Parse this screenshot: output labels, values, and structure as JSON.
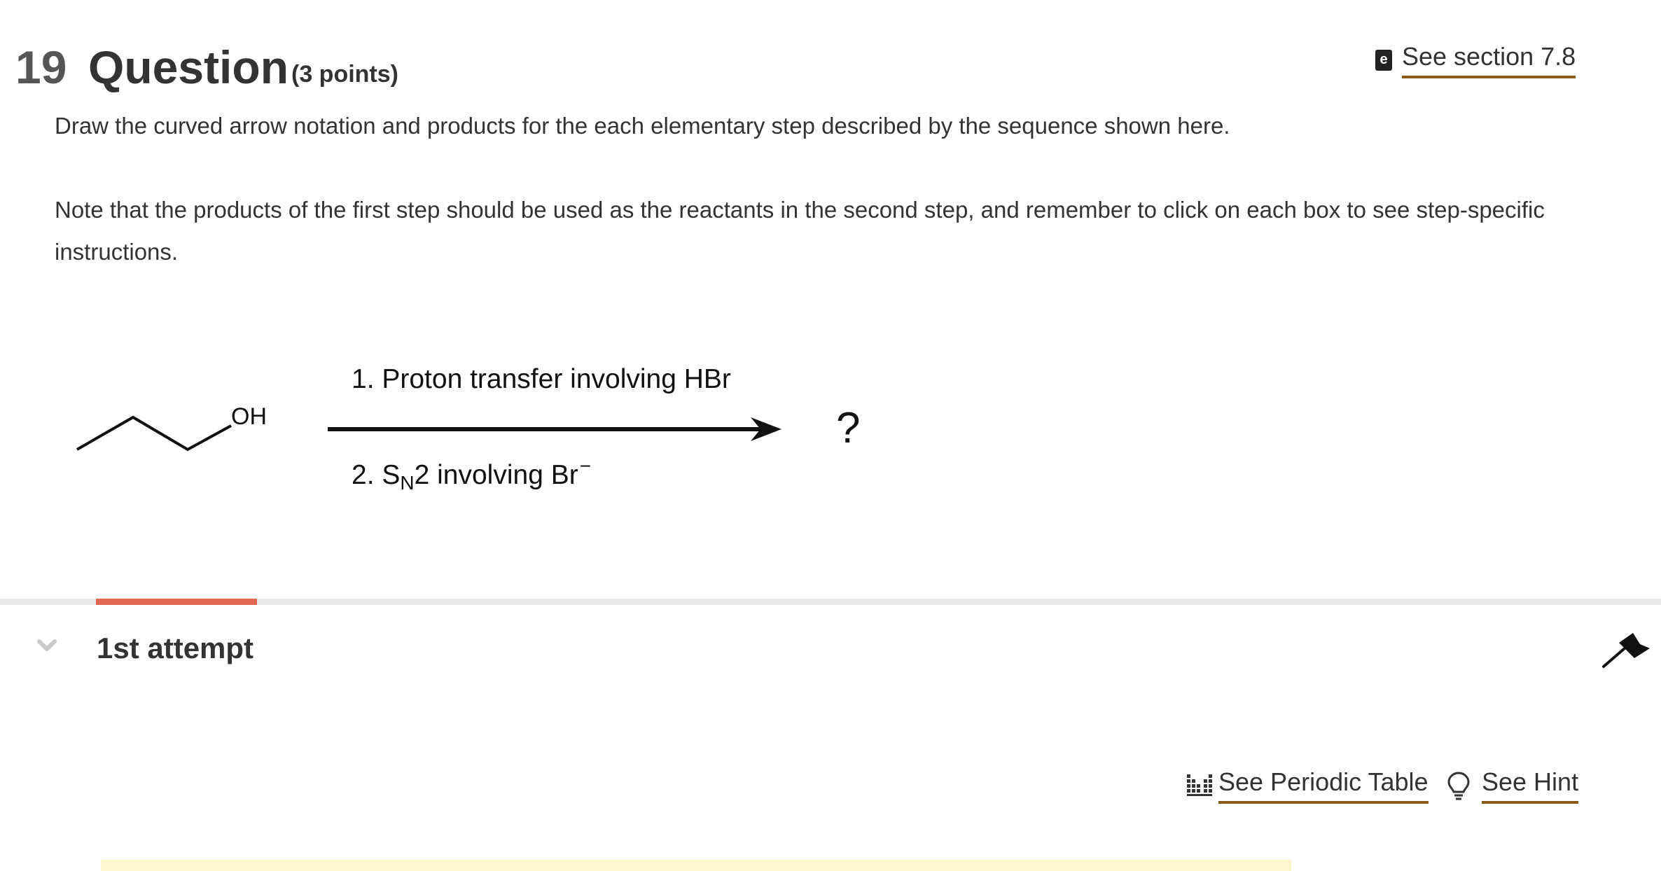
{
  "question": {
    "number": "19",
    "title": "Question",
    "points": "(3 points)",
    "ebook_link": "See section 7.8",
    "ebook_icon_letter": "e",
    "instruction": "Draw the curved arrow notation and products for the each elementary step described by the sequence shown here.",
    "note": "Note that the products of the first step should be used as the reactants in the second step, and remember to click on each box to see step-specific instructions."
  },
  "scheme": {
    "reactant_label": "OH",
    "step1": "1. Proton transfer involving HBr",
    "step2_prefix": "2. S",
    "step2_sub": "N",
    "step2_mid": "2 involving Br",
    "step2_sup": "−",
    "product": "?"
  },
  "attempt": {
    "label": "1st attempt",
    "progress_color": "#e06650"
  },
  "links": {
    "periodic_table": "See Periodic Table",
    "hint": "See Hint",
    "underline_color": "#8a5a1a"
  },
  "icons": {
    "ebook": "ebook-icon",
    "chevron": "chevron-down-icon",
    "flag": "flag-icon",
    "periodic": "periodic-table-icon",
    "hint": "lightbulb-icon"
  }
}
